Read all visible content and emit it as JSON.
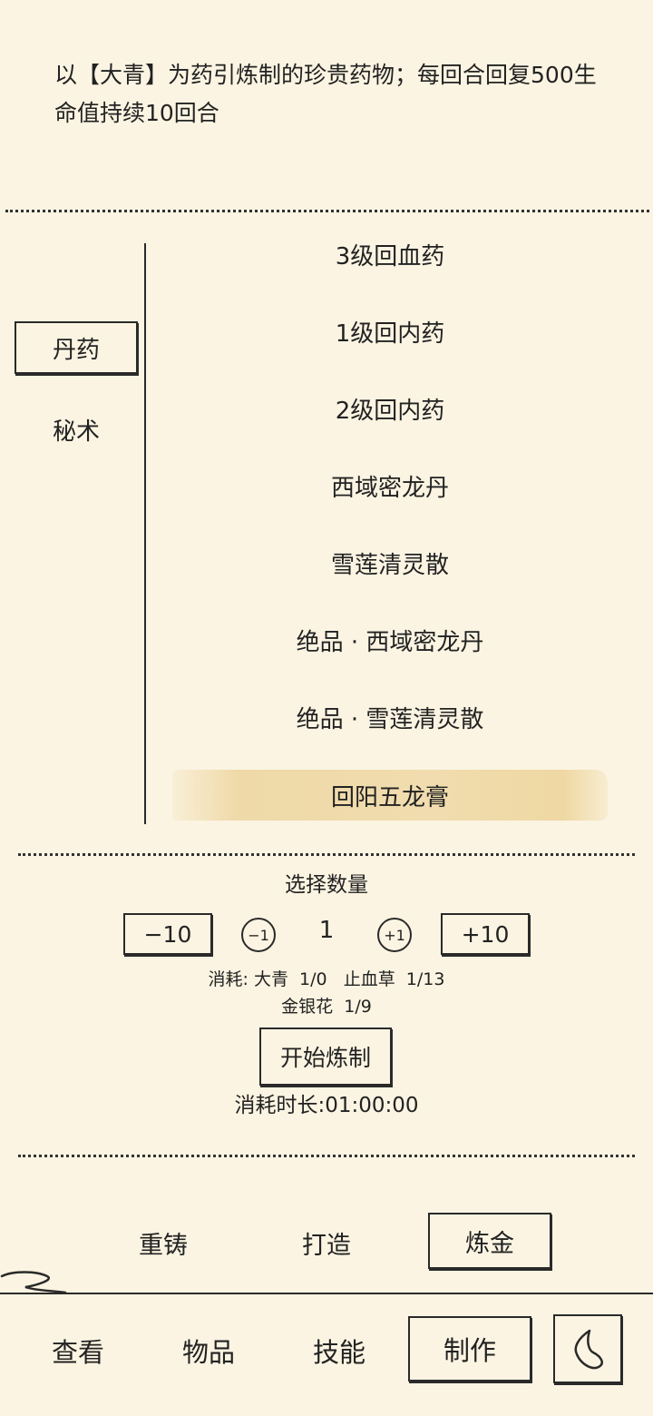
{
  "description": "以【大青】为药引炼制的珍贵药物；每回合回复500生命值持续10回合",
  "categories": [
    {
      "label": "丹药",
      "selected": true
    },
    {
      "label": "秘术",
      "selected": false
    }
  ],
  "recipes": [
    "3级回血药",
    "1级回内药",
    "2级回内药",
    "西域密龙丹",
    "雪莲清灵散",
    "绝品 · 西域密龙丹",
    "绝品 · 雪莲清灵散",
    "回阳五龙膏"
  ],
  "selected_recipe": "回阳五龙膏",
  "quantity": {
    "title": "选择数量",
    "minus10": "−10",
    "minus1": "−1",
    "value": "1",
    "plus1": "+1",
    "plus10": "+10"
  },
  "cost": {
    "line1": "消耗: 大青  1/0   止血草  1/13",
    "line2": "金银花  1/9"
  },
  "start_label": "开始炼制",
  "duration": "消耗时长:01:00:00",
  "modes": {
    "recast": "重铸",
    "forge": "打造",
    "alchemy": "炼金"
  },
  "tabs": {
    "view": "查看",
    "items": "物品",
    "skills": "技能",
    "craft": "制作"
  },
  "icons": {
    "back": "back-scribble-icon",
    "decor": "ink-swirl-icon"
  }
}
